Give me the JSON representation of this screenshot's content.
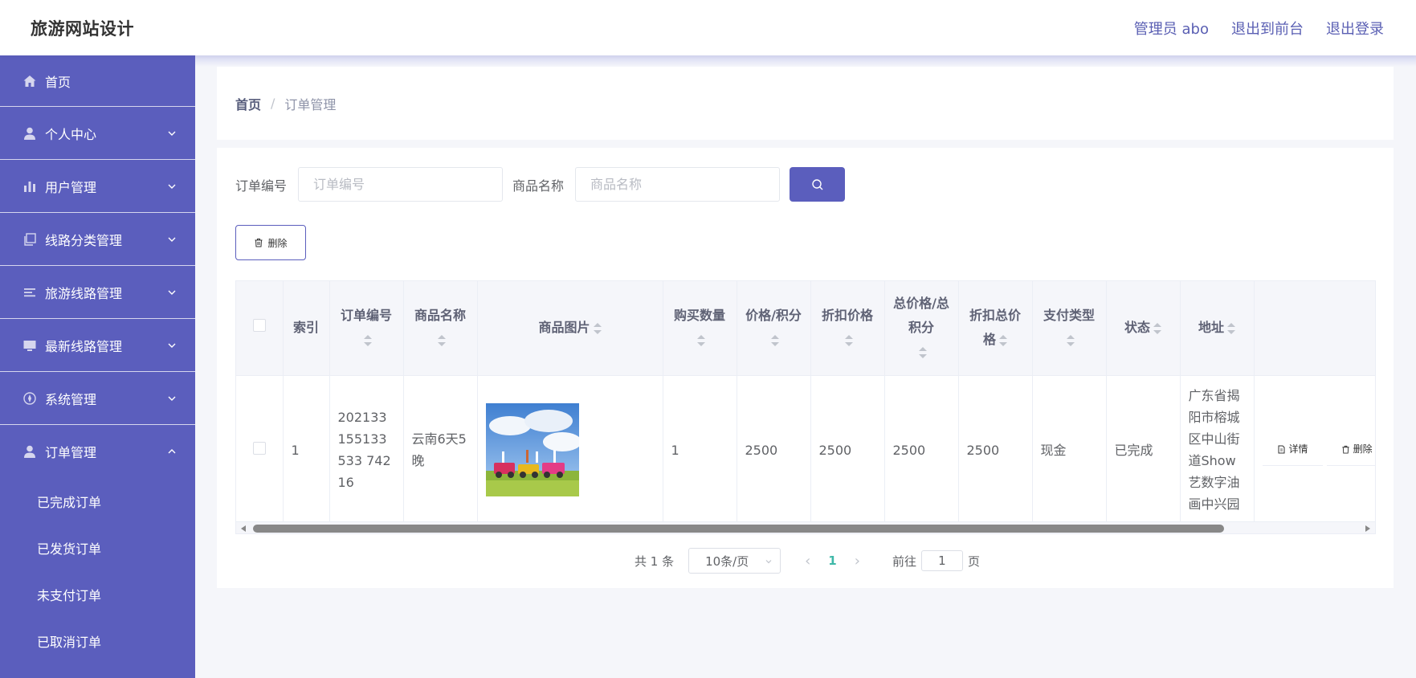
{
  "header": {
    "title": "旅游网站设计",
    "admin": "管理员 abo",
    "to_front": "退出到前台",
    "logout": "退出登录"
  },
  "sidebar": {
    "items": [
      {
        "label": "首页",
        "icon": "home-icon"
      },
      {
        "label": "个人中心",
        "icon": "user-icon"
      },
      {
        "label": "用户管理",
        "icon": "chart-icon"
      },
      {
        "label": "线路分类管理",
        "icon": "copy-icon"
      },
      {
        "label": "旅游线路管理",
        "icon": "list-icon"
      },
      {
        "label": "最新线路管理",
        "icon": "monitor-icon"
      },
      {
        "label": "系统管理",
        "icon": "compass-icon"
      },
      {
        "label": "订单管理",
        "icon": "user-icon"
      }
    ],
    "subitems": [
      "已完成订单",
      "已发货订单",
      "未支付订单",
      "已取消订单"
    ]
  },
  "breadcrumb": {
    "home": "首页",
    "separator": "/",
    "current": "订单管理"
  },
  "search": {
    "order_label": "订单编号",
    "order_placeholder": "订单编号",
    "product_label": "商品名称",
    "product_placeholder": "商品名称"
  },
  "toolbar": {
    "delete_label": "删除"
  },
  "table": {
    "headers": {
      "index": "索引",
      "order_no": "订单编号",
      "product_name": "商品名称",
      "product_image": "商品图片",
      "quantity": "购买数量",
      "price": "价格/积分",
      "discount_price": "折扣价格",
      "total": "总价格/总积分",
      "discount_total": "折扣总价格",
      "pay_type": "支付类型",
      "status": "状态",
      "address": "地址"
    },
    "rows": [
      {
        "index": "1",
        "order_no": "202133155133533 74216",
        "product_name": "云南6天5晚",
        "quantity": "1",
        "price": "2500",
        "discount_price": "2500",
        "total": "2500",
        "discount_total": "2500",
        "pay_type": "现金",
        "status": "已完成",
        "address": "广东省揭阳市榕城区中山街道Show艺数字油画中兴园",
        "detail_label": "详情",
        "delete_label": "删除"
      }
    ]
  },
  "pagination": {
    "total": "共 1 条",
    "page_size": "10条/页",
    "current": "1",
    "goto_prefix": "前往",
    "goto_value": "1",
    "goto_suffix": "页"
  }
}
